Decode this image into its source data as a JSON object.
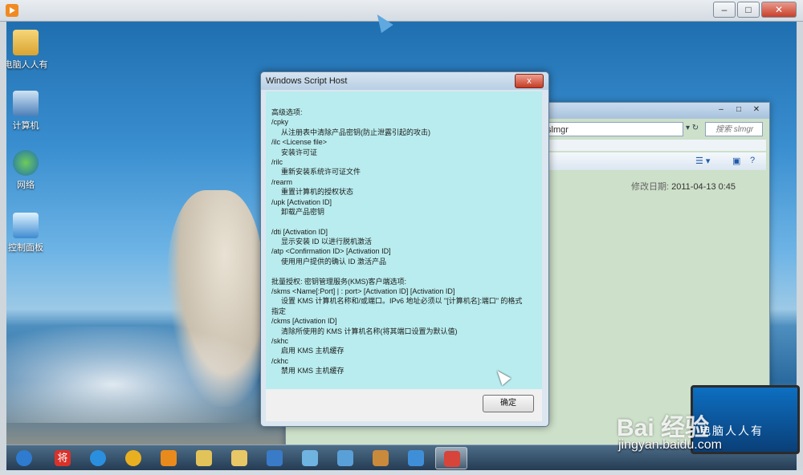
{
  "desktop": {
    "icons": [
      {
        "label": "电脑人人有",
        "icon": "folder-icon"
      },
      {
        "label": "计算机",
        "icon": "computer-icon"
      },
      {
        "label": "网络",
        "icon": "network-icon"
      },
      {
        "label": "控制面板",
        "icon": "control-panel-icon"
      }
    ]
  },
  "explorer": {
    "address": "slmgr",
    "search_placeholder": "搜索 slmgr",
    "date_label": "修改日期:",
    "date_value": "2011-04-13 0:45"
  },
  "dialog": {
    "title": "Windows Script Host",
    "close_label": "x",
    "ok_label": "确定",
    "lines": [
      {
        "text": "高级选项:",
        "indent": false
      },
      {
        "text": "/cpky",
        "indent": false
      },
      {
        "text": "从注册表中清除产品密钥(防止泄露引起的攻击)",
        "indent": true
      },
      {
        "text": "/ilc <License file>",
        "indent": false
      },
      {
        "text": "安装许可证",
        "indent": true
      },
      {
        "text": "/rilc",
        "indent": false
      },
      {
        "text": "重新安装系统许可证文件",
        "indent": true
      },
      {
        "text": "/rearm",
        "indent": false
      },
      {
        "text": "重置计算机的授权状态",
        "indent": true
      },
      {
        "text": "/upk [Activation ID]",
        "indent": false
      },
      {
        "text": "卸载产品密钥",
        "indent": true
      },
      {
        "text": "",
        "indent": false
      },
      {
        "text": "/dti [Activation ID]",
        "indent": false
      },
      {
        "text": "显示安装 ID 以进行脱机激活",
        "indent": true
      },
      {
        "text": "/atp <Confirmation ID> [Activation ID]",
        "indent": false
      },
      {
        "text": "使用用户提供的确认 ID 激活产品",
        "indent": true
      },
      {
        "text": "",
        "indent": false
      },
      {
        "text": "批量授权: 密钥管理服务(KMS)客户端选项:",
        "indent": false
      },
      {
        "text": "/skms <Name[:Port] | : port> [Activation ID] [Activation ID]",
        "indent": false
      },
      {
        "text": "设置 KMS 计算机名称和/或端口。IPv6 地址必须以 \"[计算机名]:端口\" 的格式",
        "indent": true
      },
      {
        "text": "指定",
        "indent": false
      },
      {
        "text": "/ckms [Activation ID]",
        "indent": false
      },
      {
        "text": "清除所使用的 KMS 计算机名称(将其端口设置为默认值)",
        "indent": true
      },
      {
        "text": "/skhc",
        "indent": false
      },
      {
        "text": "启用 KMS 主机缓存",
        "indent": true
      },
      {
        "text": "/ckhc",
        "indent": false
      },
      {
        "text": "禁用 KMS 主机缓存",
        "indent": true
      }
    ]
  },
  "taskbar": {
    "items": [
      {
        "icon": "start-orb-icon",
        "color": "#2e7bd0"
      },
      {
        "icon": "app-jiang-icon",
        "color": "#d9322b",
        "text": "将"
      },
      {
        "icon": "internet-explorer-icon",
        "color": "#2b8fe0"
      },
      {
        "icon": "chrome-icon",
        "color": "#e8b021"
      },
      {
        "icon": "media-player-icon",
        "color": "#e98a1c"
      },
      {
        "icon": "file-explorer-icon",
        "color": "#e2c35a"
      },
      {
        "icon": "folder-icon",
        "color": "#e8c766"
      },
      {
        "icon": "search-app-icon",
        "color": "#3a7bc8"
      },
      {
        "icon": "pinwheel-app-icon",
        "color": "#6fb3e0"
      },
      {
        "icon": "remote-desktop-icon",
        "color": "#5aa0d8"
      },
      {
        "icon": "paint-icon",
        "color": "#c98a3b"
      },
      {
        "icon": "settings-app-icon",
        "color": "#3f8fd8"
      },
      {
        "icon": "script-host-icon",
        "color": "#d7443a"
      }
    ]
  },
  "watermark": {
    "logo": "Bai 经验",
    "url": "jingyan.baidu.com",
    "laptop_text": "电脑人人有"
  }
}
